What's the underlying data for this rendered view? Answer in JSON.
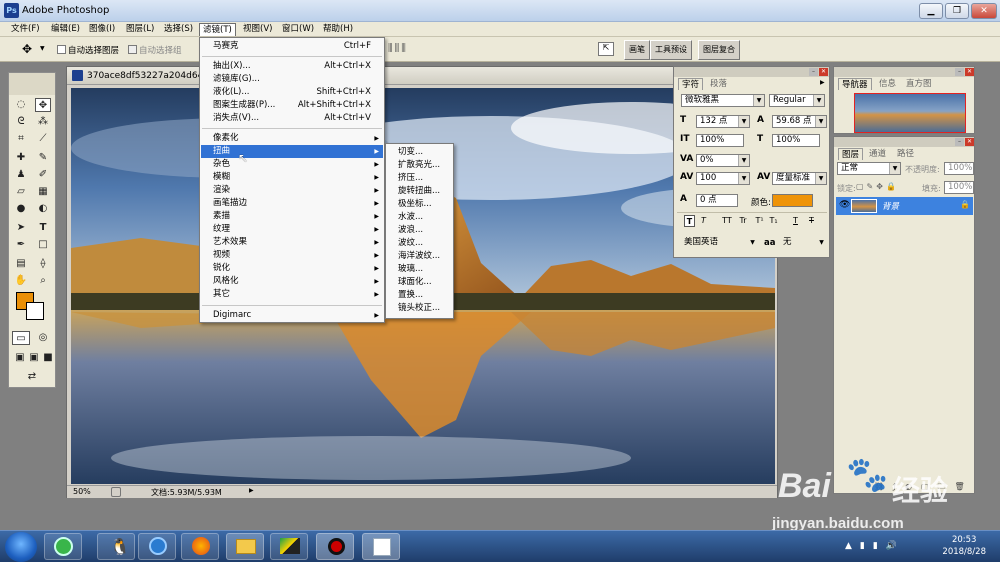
{
  "window": {
    "title": "Adobe Photoshop"
  },
  "menubar": [
    "文件(F)",
    "编辑(E)",
    "图像(I)",
    "图层(L)",
    "选择(S)",
    "滤镜(T)",
    "视图(V)",
    "窗口(W)",
    "帮助(H)"
  ],
  "options": {
    "auto_select_layer": "自动选择图层",
    "auto_select_group": "自动选择组"
  },
  "wells": [
    "画笔",
    "工具预设",
    "图层复合"
  ],
  "document": {
    "title": "370ace8df53227a204d64c",
    "zoom": "50%",
    "doc_size": "文档:5.93M/5.93M"
  },
  "filter_menu": {
    "items": [
      {
        "label": "马赛克",
        "shortcut": "Ctrl+F"
      },
      {
        "label": "抽出(X)...",
        "shortcut": "Alt+Ctrl+X"
      },
      {
        "label": "滤镜库(G)...",
        "shortcut": ""
      },
      {
        "label": "液化(L)...",
        "shortcut": "Shift+Ctrl+X"
      },
      {
        "label": "图案生成器(P)...",
        "shortcut": "Alt+Shift+Ctrl+X"
      },
      {
        "label": "消失点(V)...",
        "shortcut": "Alt+Ctrl+V"
      },
      {
        "label": "像素化",
        "shortcut": ""
      },
      {
        "label": "扭曲",
        "shortcut": ""
      },
      {
        "label": "杂色",
        "shortcut": ""
      },
      {
        "label": "模糊",
        "shortcut": ""
      },
      {
        "label": "渲染",
        "shortcut": ""
      },
      {
        "label": "画笔描边",
        "shortcut": ""
      },
      {
        "label": "素描",
        "shortcut": ""
      },
      {
        "label": "纹理",
        "shortcut": ""
      },
      {
        "label": "艺术效果",
        "shortcut": ""
      },
      {
        "label": "视频",
        "shortcut": ""
      },
      {
        "label": "锐化",
        "shortcut": ""
      },
      {
        "label": "风格化",
        "shortcut": ""
      },
      {
        "label": "其它",
        "shortcut": ""
      },
      {
        "label": "Digimarc",
        "shortcut": ""
      }
    ]
  },
  "distort_menu": [
    "切变...",
    "扩散亮光...",
    "挤压...",
    "旋转扭曲...",
    "极坐标...",
    "水波...",
    "波浪...",
    "波纹...",
    "海洋波纹...",
    "玻璃...",
    "球面化...",
    "置换...",
    "镜头校正..."
  ],
  "character": {
    "tabs": [
      "字符",
      "段落"
    ],
    "font": "微软雅黑",
    "style": "Regular",
    "size": "132 点",
    "leading": "59.68 点",
    "vscale": "100%",
    "hscale": "100%",
    "tracking": "0%",
    "kerning": "100",
    "kerning_mode": "度量标准",
    "baseline": "0 点",
    "color_label": "颜色:",
    "color": "#ee9308",
    "language": "美国英语",
    "aa_label": "aa",
    "antialias": "无",
    "style_buttons": [
      "T",
      "T",
      "TT",
      "Tr",
      "T¹",
      "T₁",
      "T",
      "T"
    ]
  },
  "navigator": {
    "tabs": [
      "导航器",
      "信息",
      "直方图"
    ]
  },
  "layers": {
    "tabs": [
      "图层",
      "通道",
      "路径"
    ],
    "blend": "正常",
    "opacity_label": "不透明度:",
    "opacity": "100%",
    "lock_label": "锁定:",
    "fill_label": "填充:",
    "fill": "100%",
    "layer_name": "背景"
  },
  "taskbar": {
    "time": "20:53",
    "date": "2018/8/28"
  },
  "watermark": {
    "brand": "Bai",
    "brand2": "经验",
    "url": "jingyan.baidu.com"
  }
}
